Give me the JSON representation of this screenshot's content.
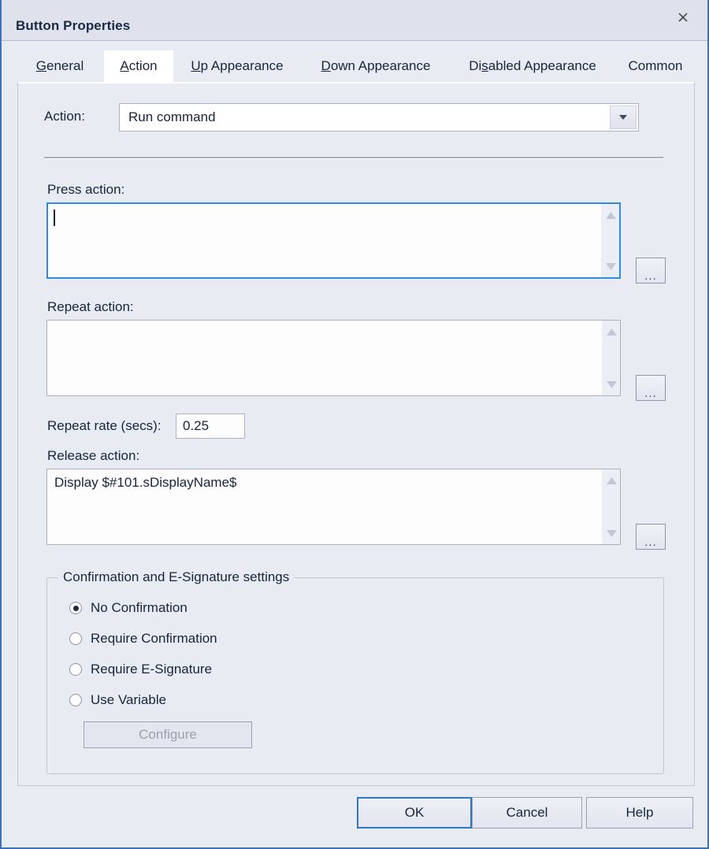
{
  "window": {
    "title": "Button Properties",
    "close_icon": "close-icon"
  },
  "tabs": [
    {
      "label": "General",
      "accel": "G",
      "active": false
    },
    {
      "label": "Action",
      "accel": "A",
      "active": true
    },
    {
      "label": "Up Appearance",
      "accel": "U",
      "active": false
    },
    {
      "label": "Down Appearance",
      "accel": "D",
      "active": false
    },
    {
      "label": "Disabled Appearance",
      "accel": "s",
      "active": false
    },
    {
      "label": "Common",
      "accel": "",
      "active": false
    }
  ],
  "action_tab": {
    "action_label": "Action:",
    "action_value": "Run command",
    "action_dropdown_icon": "chevron-down-icon",
    "press_action_label": "Press action:",
    "press_action_value": "",
    "press_browse_label": "...",
    "repeat_action_label": "Repeat action:",
    "repeat_action_value": "",
    "repeat_browse_label": "...",
    "repeat_rate_label": "Repeat rate (secs):",
    "repeat_rate_value": "0.25",
    "release_action_label": "Release action:",
    "release_action_value": "Display $#101.sDisplayName$",
    "release_browse_label": "...",
    "confirmation": {
      "group_title": "Confirmation and E-Signature settings",
      "options": [
        {
          "label": "No Confirmation",
          "selected": true
        },
        {
          "label": "Require Confirmation",
          "selected": false
        },
        {
          "label": "Require E-Signature",
          "selected": false
        },
        {
          "label": "Use Variable",
          "selected": false
        }
      ],
      "configure_label": "Configure",
      "configure_enabled": false
    }
  },
  "footer": {
    "ok_label": "OK",
    "cancel_label": "Cancel",
    "help_label": "Help"
  },
  "colors": {
    "dialog_border": "#3d72b8",
    "focus_blue": "#2d8ae5",
    "default_button_blue": "#2d77c7",
    "background": "#e9ebf3",
    "text": "#16253c"
  }
}
